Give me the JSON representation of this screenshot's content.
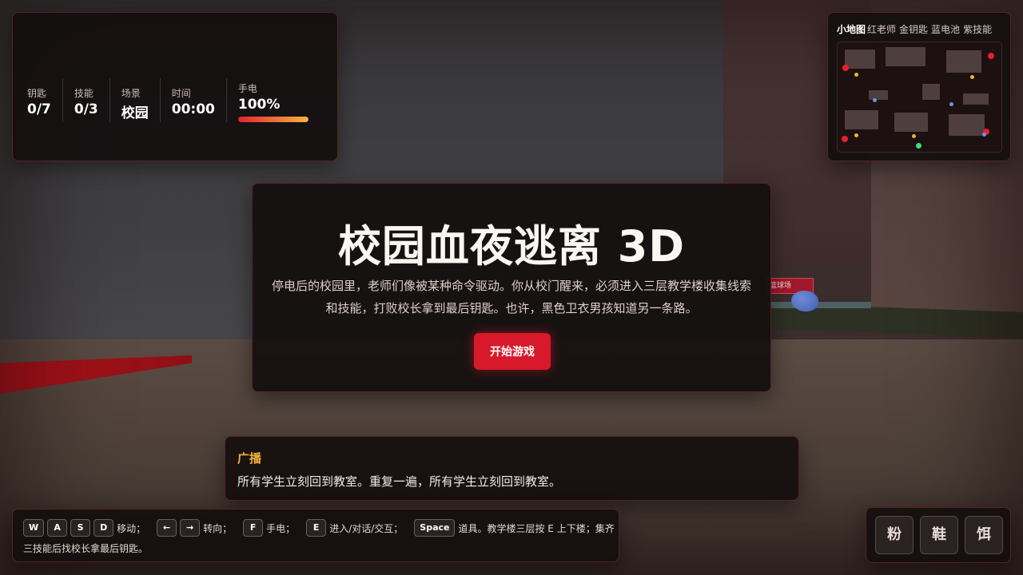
{
  "scene": {
    "sign_text": "篮球场"
  },
  "hud": {
    "stats": [
      {
        "label": "钥匙",
        "value": "0/7"
      },
      {
        "label": "技能",
        "value": "0/3"
      },
      {
        "label": "场景",
        "value": "校园"
      },
      {
        "label": "时间",
        "value": "00:00"
      }
    ],
    "torch": {
      "label": "手电",
      "value": "100%",
      "level": 1.0
    }
  },
  "minimap": {
    "title": "小地图",
    "legend": [
      "红老师",
      "金钥匙",
      "蓝电池",
      "紫技能"
    ],
    "colors": {
      "teacher": "#e4202c",
      "key": "#f0b23a",
      "battery": "#6c93e4",
      "player": "#3ddc7a"
    }
  },
  "intro": {
    "title": "校园血夜逃离 3D",
    "description": "停电后的校园里，老师们像被某种命令驱动。你从校门醒来，必须进入三层教学楼收集线索和技能，打败校长拿到最后钥匙。也许，黑色卫衣男孩知道另一条路。",
    "start_label": "开始游戏"
  },
  "broadcast": {
    "title": "广播",
    "text": "所有学生立刻回到教室。重复一遍，所有学生立刻回到教室。"
  },
  "help": {
    "move_keys": [
      "W",
      "A",
      "S",
      "D"
    ],
    "move_label": "移动；",
    "turn_keys": [
      "←",
      "→"
    ],
    "turn_label": "转向；",
    "torch_key": "F",
    "torch_label": "手电；",
    "interact_key": "E",
    "interact_label": "进入/对话/交互；",
    "item_key": "Space",
    "item_label": "道具。教学楼三层按 E 上下楼；集齐",
    "line2": "三技能后找校长拿最后钥匙。"
  },
  "inventory": {
    "slots": [
      "粉",
      "鞋",
      "饵"
    ]
  }
}
